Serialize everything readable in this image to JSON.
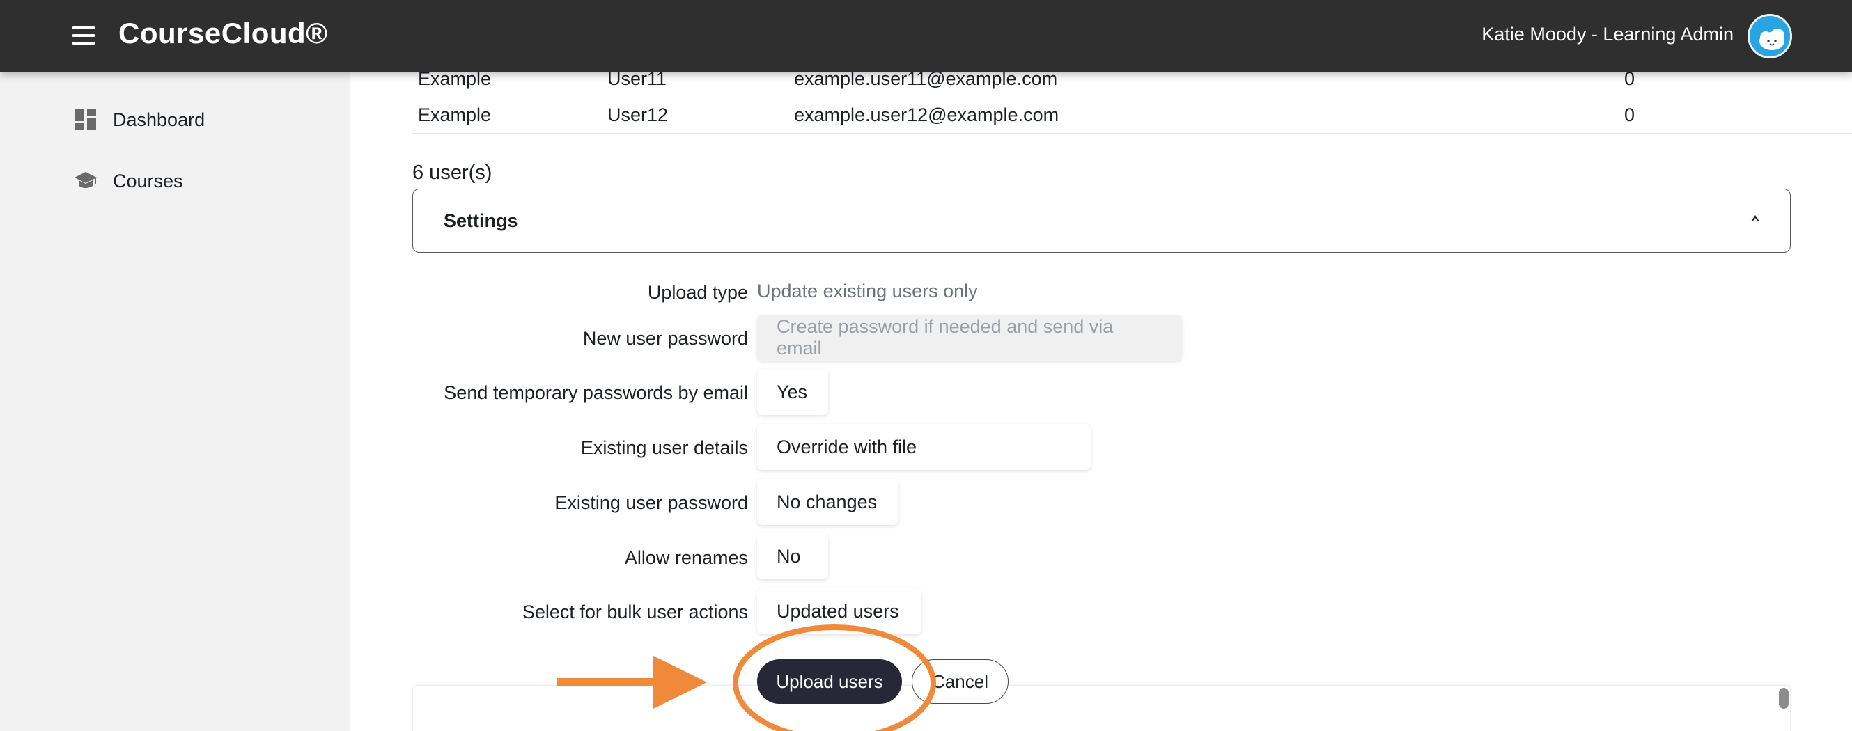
{
  "app": {
    "brand": "CourseCloud®",
    "user": "Katie Moody - Learning Admin"
  },
  "sidebar": {
    "items": [
      {
        "label": "Dashboard",
        "icon": "dashboard-icon"
      },
      {
        "label": "Courses",
        "icon": "graduation-cap-icon"
      }
    ]
  },
  "table": {
    "rows": [
      {
        "first": "Example",
        "last": "User11",
        "email": "example.user11@example.com",
        "count": "0"
      },
      {
        "first": "Example",
        "last": "User12",
        "email": "example.user12@example.com",
        "count": "0"
      }
    ]
  },
  "summary": {
    "user_count": "6 user(s)"
  },
  "settings": {
    "title": "Settings",
    "upload_type_label": "Upload type",
    "upload_type_value": "Update existing users only",
    "new_password_label": "New user password",
    "new_password_value": "Create password if needed and send via email",
    "send_temp_label": "Send temporary passwords by email",
    "send_temp_value": "Yes",
    "existing_details_label": "Existing user details",
    "existing_details_value": "Override with file",
    "existing_password_label": "Existing user password",
    "existing_password_value": "No changes",
    "allow_renames_label": "Allow renames",
    "allow_renames_value": "No",
    "bulk_actions_label": "Select for bulk user actions",
    "bulk_actions_value": "Updated users"
  },
  "actions": {
    "upload_label": "Upload users",
    "cancel_label": "Cancel"
  },
  "colors": {
    "topbar": "#2f2f2f",
    "sidebar": "#f2f2f2",
    "primary_button": "#272738",
    "annotation": "#f08a3a",
    "avatar": "#2aa3e3"
  }
}
